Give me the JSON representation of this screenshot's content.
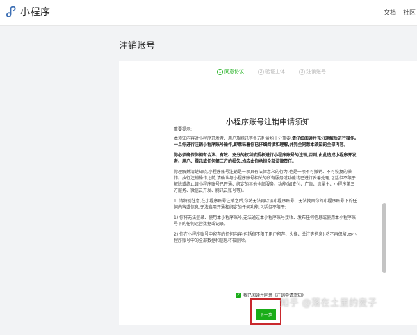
{
  "header": {
    "app_name": "小程序",
    "nav": {
      "docs": "文档",
      "community": "社区"
    }
  },
  "page": {
    "title": "注销账号"
  },
  "steps": [
    {
      "num": "1",
      "label": "同意协议"
    },
    {
      "num": "2",
      "label": "验证主体"
    },
    {
      "num": "3",
      "label": "注销账号"
    }
  ],
  "notice": {
    "title": "小程序账号注销申请须知",
    "heading": "重要提示:",
    "p1_normal": "本须知内容对小程序开发者、用户及腾讯等各方利益均十分重要,",
    "p1_bold": "请仔细阅读并充分理解后进行操作。一旦你进行注销小程序账号操作,即意味着你已仔细阅读和理解,并完全同意本须知的全部内容。",
    "p2": "你必须确保你拥有合法、有效、充分的权利或授权进行小程序账号的注销,否则,由此造成小程序开发者、用户、腾讯或任何第三方的损失,均应由你承担全部法律责任。",
    "p3": "你理解并清楚知晓,小程序账号注销是一项具有法律意义的行为,也是一项不可撤销、不可恢复的操作。执行注销操作之前,请确认与小程序账号相关的所有服务或功能均已进行妥善处理,包括但不限于解除或终止该小程序账号已开通、绑定的其他全部服务、功能(如支付、广告、流量主、小程序第三方服务、微信云开发、腾讯云账号等)。",
    "p4": "1. 请特别注意,在小程序账号注销之后,你将无法再以该小程序账号、无法找回你的小程序账号下的任何内容或信息,无法启用开通和绑定的任何功能,包括但不限于:",
    "p5": "1) 你将无法登录、使用本小程序账号,无法通过本小程序账号接收、发布任何信息或使用本小程序账号下的任何运营数据或记录。",
    "p6": "2) 你在小程序账号中留存的任何内容(包括但不限于用户留存、头像、关注等信息),将不再保留,本小程序账号中的全部数据和信息将被删除。"
  },
  "agree": {
    "checkbox_checked": true,
    "label": "我已阅读并同意《注销申请须知》"
  },
  "actions": {
    "next_label": "下一步"
  },
  "watermark": "知乎 @落在土里的麦子",
  "colors": {
    "accent": "#1aad19",
    "highlight": "#c9282d",
    "background": "#f2f3f5"
  }
}
